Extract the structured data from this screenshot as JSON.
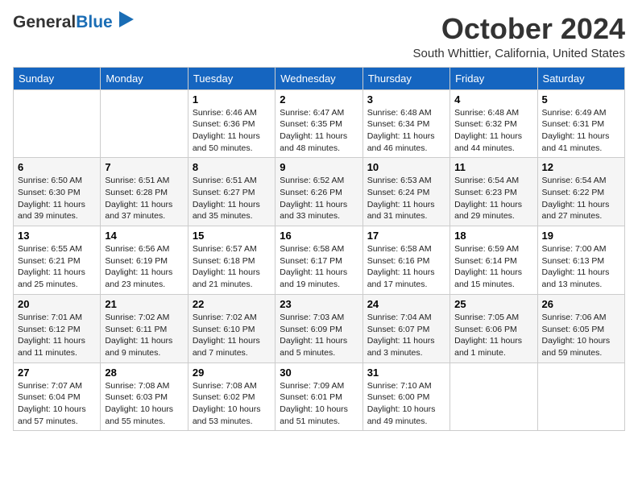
{
  "logo": {
    "general": "General",
    "blue": "Blue"
  },
  "title": "October 2024",
  "location": "South Whittier, California, United States",
  "weekdays": [
    "Sunday",
    "Monday",
    "Tuesday",
    "Wednesday",
    "Thursday",
    "Friday",
    "Saturday"
  ],
  "weeks": [
    [
      {
        "day": "",
        "sunrise": "",
        "sunset": "",
        "daylight": ""
      },
      {
        "day": "",
        "sunrise": "",
        "sunset": "",
        "daylight": ""
      },
      {
        "day": "1",
        "sunrise": "Sunrise: 6:46 AM",
        "sunset": "Sunset: 6:36 PM",
        "daylight": "Daylight: 11 hours and 50 minutes."
      },
      {
        "day": "2",
        "sunrise": "Sunrise: 6:47 AM",
        "sunset": "Sunset: 6:35 PM",
        "daylight": "Daylight: 11 hours and 48 minutes."
      },
      {
        "day": "3",
        "sunrise": "Sunrise: 6:48 AM",
        "sunset": "Sunset: 6:34 PM",
        "daylight": "Daylight: 11 hours and 46 minutes."
      },
      {
        "day": "4",
        "sunrise": "Sunrise: 6:48 AM",
        "sunset": "Sunset: 6:32 PM",
        "daylight": "Daylight: 11 hours and 44 minutes."
      },
      {
        "day": "5",
        "sunrise": "Sunrise: 6:49 AM",
        "sunset": "Sunset: 6:31 PM",
        "daylight": "Daylight: 11 hours and 41 minutes."
      }
    ],
    [
      {
        "day": "6",
        "sunrise": "Sunrise: 6:50 AM",
        "sunset": "Sunset: 6:30 PM",
        "daylight": "Daylight: 11 hours and 39 minutes."
      },
      {
        "day": "7",
        "sunrise": "Sunrise: 6:51 AM",
        "sunset": "Sunset: 6:28 PM",
        "daylight": "Daylight: 11 hours and 37 minutes."
      },
      {
        "day": "8",
        "sunrise": "Sunrise: 6:51 AM",
        "sunset": "Sunset: 6:27 PM",
        "daylight": "Daylight: 11 hours and 35 minutes."
      },
      {
        "day": "9",
        "sunrise": "Sunrise: 6:52 AM",
        "sunset": "Sunset: 6:26 PM",
        "daylight": "Daylight: 11 hours and 33 minutes."
      },
      {
        "day": "10",
        "sunrise": "Sunrise: 6:53 AM",
        "sunset": "Sunset: 6:24 PM",
        "daylight": "Daylight: 11 hours and 31 minutes."
      },
      {
        "day": "11",
        "sunrise": "Sunrise: 6:54 AM",
        "sunset": "Sunset: 6:23 PM",
        "daylight": "Daylight: 11 hours and 29 minutes."
      },
      {
        "day": "12",
        "sunrise": "Sunrise: 6:54 AM",
        "sunset": "Sunset: 6:22 PM",
        "daylight": "Daylight: 11 hours and 27 minutes."
      }
    ],
    [
      {
        "day": "13",
        "sunrise": "Sunrise: 6:55 AM",
        "sunset": "Sunset: 6:21 PM",
        "daylight": "Daylight: 11 hours and 25 minutes."
      },
      {
        "day": "14",
        "sunrise": "Sunrise: 6:56 AM",
        "sunset": "Sunset: 6:19 PM",
        "daylight": "Daylight: 11 hours and 23 minutes."
      },
      {
        "day": "15",
        "sunrise": "Sunrise: 6:57 AM",
        "sunset": "Sunset: 6:18 PM",
        "daylight": "Daylight: 11 hours and 21 minutes."
      },
      {
        "day": "16",
        "sunrise": "Sunrise: 6:58 AM",
        "sunset": "Sunset: 6:17 PM",
        "daylight": "Daylight: 11 hours and 19 minutes."
      },
      {
        "day": "17",
        "sunrise": "Sunrise: 6:58 AM",
        "sunset": "Sunset: 6:16 PM",
        "daylight": "Daylight: 11 hours and 17 minutes."
      },
      {
        "day": "18",
        "sunrise": "Sunrise: 6:59 AM",
        "sunset": "Sunset: 6:14 PM",
        "daylight": "Daylight: 11 hours and 15 minutes."
      },
      {
        "day": "19",
        "sunrise": "Sunrise: 7:00 AM",
        "sunset": "Sunset: 6:13 PM",
        "daylight": "Daylight: 11 hours and 13 minutes."
      }
    ],
    [
      {
        "day": "20",
        "sunrise": "Sunrise: 7:01 AM",
        "sunset": "Sunset: 6:12 PM",
        "daylight": "Daylight: 11 hours and 11 minutes."
      },
      {
        "day": "21",
        "sunrise": "Sunrise: 7:02 AM",
        "sunset": "Sunset: 6:11 PM",
        "daylight": "Daylight: 11 hours and 9 minutes."
      },
      {
        "day": "22",
        "sunrise": "Sunrise: 7:02 AM",
        "sunset": "Sunset: 6:10 PM",
        "daylight": "Daylight: 11 hours and 7 minutes."
      },
      {
        "day": "23",
        "sunrise": "Sunrise: 7:03 AM",
        "sunset": "Sunset: 6:09 PM",
        "daylight": "Daylight: 11 hours and 5 minutes."
      },
      {
        "day": "24",
        "sunrise": "Sunrise: 7:04 AM",
        "sunset": "Sunset: 6:07 PM",
        "daylight": "Daylight: 11 hours and 3 minutes."
      },
      {
        "day": "25",
        "sunrise": "Sunrise: 7:05 AM",
        "sunset": "Sunset: 6:06 PM",
        "daylight": "Daylight: 11 hours and 1 minute."
      },
      {
        "day": "26",
        "sunrise": "Sunrise: 7:06 AM",
        "sunset": "Sunset: 6:05 PM",
        "daylight": "Daylight: 10 hours and 59 minutes."
      }
    ],
    [
      {
        "day": "27",
        "sunrise": "Sunrise: 7:07 AM",
        "sunset": "Sunset: 6:04 PM",
        "daylight": "Daylight: 10 hours and 57 minutes."
      },
      {
        "day": "28",
        "sunrise": "Sunrise: 7:08 AM",
        "sunset": "Sunset: 6:03 PM",
        "daylight": "Daylight: 10 hours and 55 minutes."
      },
      {
        "day": "29",
        "sunrise": "Sunrise: 7:08 AM",
        "sunset": "Sunset: 6:02 PM",
        "daylight": "Daylight: 10 hours and 53 minutes."
      },
      {
        "day": "30",
        "sunrise": "Sunrise: 7:09 AM",
        "sunset": "Sunset: 6:01 PM",
        "daylight": "Daylight: 10 hours and 51 minutes."
      },
      {
        "day": "31",
        "sunrise": "Sunrise: 7:10 AM",
        "sunset": "Sunset: 6:00 PM",
        "daylight": "Daylight: 10 hours and 49 minutes."
      },
      {
        "day": "",
        "sunrise": "",
        "sunset": "",
        "daylight": ""
      },
      {
        "day": "",
        "sunrise": "",
        "sunset": "",
        "daylight": ""
      }
    ]
  ]
}
